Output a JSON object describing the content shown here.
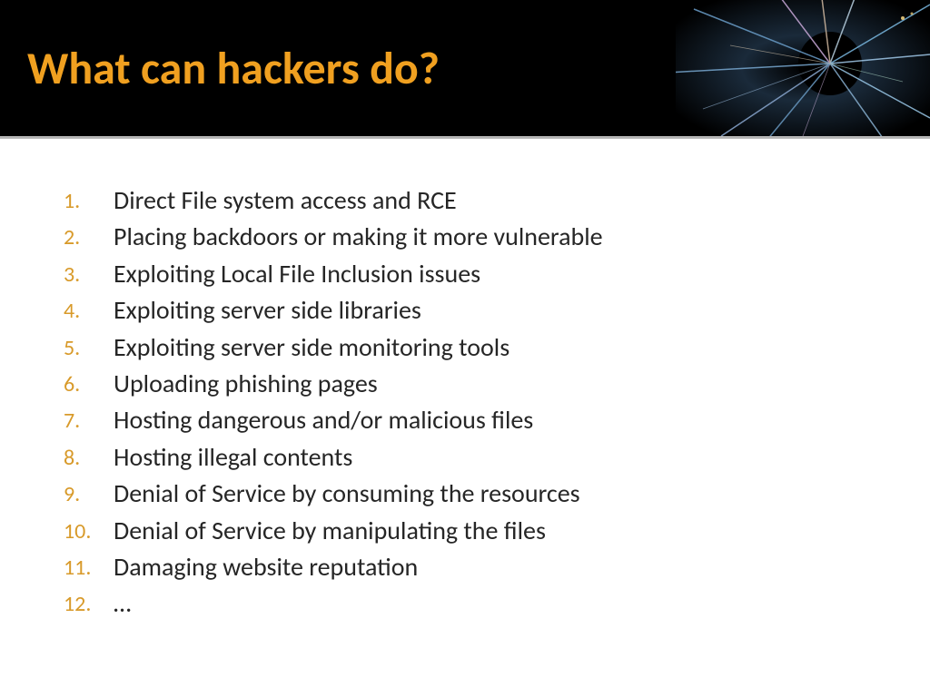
{
  "header": {
    "title": "What can hackers do?"
  },
  "list": {
    "items": [
      "Direct File system access and RCE",
      "Placing backdoors or making it more vulnerable",
      "Exploiting Local File Inclusion issues",
      "Exploiting server side libraries",
      "Exploiting server side monitoring tools",
      "Uploading phishing pages",
      "Hosting dangerous and/or malicious files",
      "Hosting illegal contents",
      "Denial of Service by consuming the resources",
      "Denial of Service by manipulating the files",
      "Damaging website reputation",
      "…"
    ]
  },
  "colors": {
    "accent": "#f0a020",
    "listNumber": "#d89a2a",
    "text": "#262626",
    "headerBg": "#000000"
  }
}
